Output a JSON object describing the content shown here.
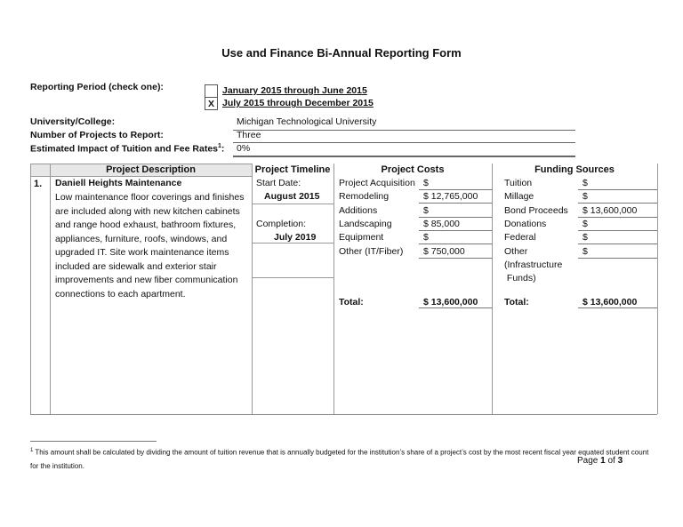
{
  "form": {
    "title": "Use and Finance Bi-Annual Reporting Form",
    "reporting_period_label": "Reporting Period (check one):",
    "periods": [
      {
        "label": "January 2015 through June 2015",
        "mark": ""
      },
      {
        "label": "July 2015 through December 2015",
        "mark": "X"
      }
    ],
    "fields": [
      {
        "label": "University/College:",
        "value": "Michigan Technological University"
      },
      {
        "label": "Number of Projects to Report:",
        "value": "Three"
      },
      {
        "label": "Estimated Impact of Tuition and Fee Rates",
        "sup": "1",
        "suffix": ":",
        "value": "0%"
      }
    ]
  },
  "table": {
    "headers": {
      "description": "Project Description",
      "timeline": "Project Timeline",
      "costs": "Project Costs",
      "funding": "Funding Sources"
    },
    "project": {
      "number": "1.",
      "name": "Daniell Heights Maintenance",
      "description": "Low maintenance floor coverings and finishes are included along with new kitchen cabinets and range hood exhaust, bathroom fixtures, appliances, furniture, roofs, windows, and upgraded IT. Site work maintenance items included are sidewalk and exterior stair improvements and new fiber communication connections to each apartment.",
      "start_label": "Start Date:",
      "start_value": "August 2015",
      "completion_label": "Completion:",
      "completion_value": "July 2019",
      "costs": [
        {
          "label": "Project Acquisition",
          "value": "$"
        },
        {
          "label": "Remodeling",
          "value": "$ 12,765,000"
        },
        {
          "label": "Additions",
          "value": "$"
        },
        {
          "label": "Landscaping",
          "value": "$ 85,000"
        },
        {
          "label": "Equipment",
          "value": "$"
        },
        {
          "label": "Other (IT/Fiber)",
          "value": "$ 750,000"
        }
      ],
      "costs_total_label": "Total:",
      "costs_total_value": "$ 13,600,000",
      "funding": [
        {
          "label": "Tuition",
          "value": "$"
        },
        {
          "label": "Millage",
          "value": "$"
        },
        {
          "label": "Bond Proceeds",
          "value": "$ 13,600,000"
        },
        {
          "label": "Donations",
          "value": "$"
        },
        {
          "label": "Federal",
          "value": "$"
        },
        {
          "label": "Other",
          "value": "$"
        },
        {
          "label": "(Infrastructure",
          "value": ""
        },
        {
          "label": " Funds)",
          "value": ""
        }
      ],
      "funding_total_label": "Total:",
      "funding_total_value": "$ 13,600,000"
    }
  },
  "footnote": {
    "marker": "1",
    "text": "This amount shall be calculated by dividing the amount of tuition revenue that is annually budgeted for the institution’s share of a project’s cost by the most recent fiscal year equated student count for the institution."
  },
  "page": {
    "prefix": "Page ",
    "current": "1",
    "of": " of ",
    "total": "3"
  }
}
